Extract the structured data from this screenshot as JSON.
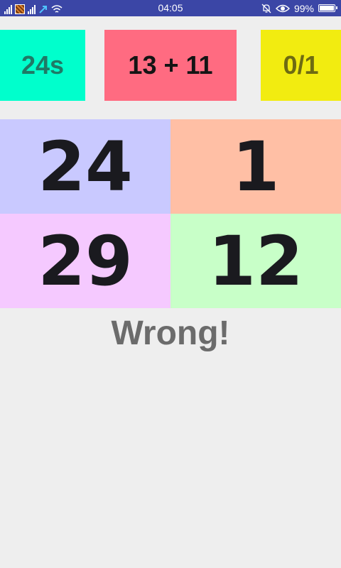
{
  "status_bar": {
    "time": "04:05",
    "battery_percent_text": "99%",
    "battery_level": 0.99,
    "icons": [
      "signal-icon",
      "carrier-logo-icon",
      "signal-icon",
      "data-arrow-icon",
      "wifi-icon",
      "mute-bell-icon",
      "eye-icon",
      "battery-icon"
    ],
    "background_color": "#3b46a6"
  },
  "game": {
    "timer": "24s",
    "question": "13 + 11",
    "score": "0/1",
    "answers": [
      "24",
      "1",
      "29",
      "12"
    ],
    "feedback": "Wrong!"
  },
  "colors": {
    "timer_bg": "#00ffcc",
    "question_bg": "#ff6b81",
    "score_bg": "#f2ec10",
    "tile_colors": [
      "#c9c9ff",
      "#ffbfa5",
      "#f5c9ff",
      "#c8ffc8"
    ],
    "app_bg": "#eeeeee"
  }
}
